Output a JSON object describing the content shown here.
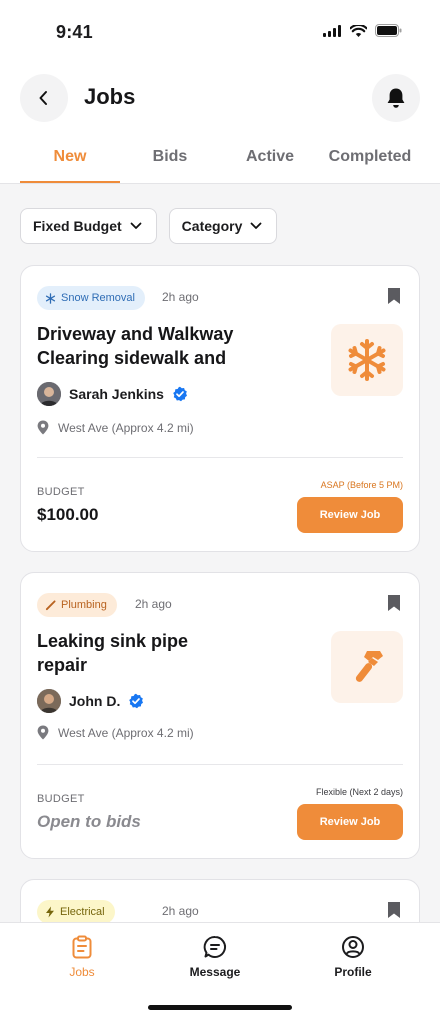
{
  "status_bar": {
    "time": "9:41"
  },
  "header": {
    "title": "Jobs"
  },
  "tabs": [
    {
      "label": "New",
      "active": true
    },
    {
      "label": "Bids",
      "active": false
    },
    {
      "label": "Active",
      "active": false
    },
    {
      "label": "Completed",
      "active": false
    }
  ],
  "filters": [
    {
      "label": "Fixed Budget"
    },
    {
      "label": "Category"
    }
  ],
  "jobs": [
    {
      "category": "Snow Removal",
      "posted": "2h ago",
      "title": "Driveway and Walkway Clearing sidewalk and",
      "poster": "Sarah Jenkins",
      "location": "West Ave (Approx 4.2 mi)",
      "budget_label": "BUDGET",
      "budget": "$100.00",
      "timing": "ASAP (Before 5 PM)",
      "action": "Review Job",
      "image_icon": "snowflake-icon"
    },
    {
      "category": "Plumbing",
      "posted": "2h ago",
      "title": "Leaking sink pipe repair",
      "poster": "John D.",
      "location": "West Ave (Approx 4.2 mi)",
      "budget_label": "BUDGET",
      "budget": "Open to bids",
      "timing": "Flexible (Next 2 days)",
      "action": "Review Job",
      "image_icon": "wrench-icon"
    },
    {
      "category": "Electrical",
      "posted": "2h ago"
    }
  ],
  "bottom_nav": [
    {
      "label": "Jobs",
      "icon": "clipboard-icon",
      "active": true
    },
    {
      "label": "Message",
      "icon": "chat-icon",
      "active": false
    },
    {
      "label": "Profile",
      "icon": "profile-icon",
      "active": false
    }
  ],
  "colors": {
    "accent": "#ef8c3a",
    "verified": "#1877f2"
  }
}
